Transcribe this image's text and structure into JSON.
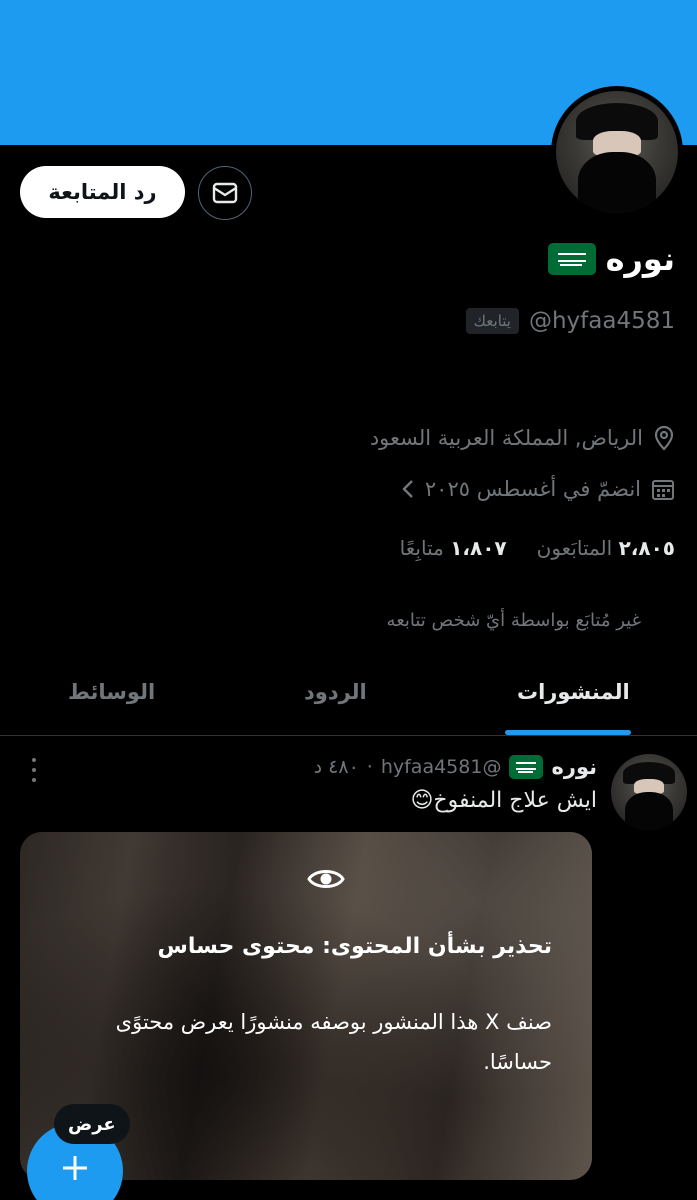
{
  "profile": {
    "name": "نوره",
    "flag_icon": "saudi-flag-icon",
    "handle": "@hyfaa4581",
    "follows_you": "يتابعك",
    "location": "الرياض, المملكة العربية السعود",
    "joined": "انضمّ في أغسطس ٢٠٢٥",
    "followers_count": "٢،٨٠٥",
    "followers_label": "المتابَعون",
    "following_count": "١،٨٠٧",
    "following_label": "متابِعًا",
    "not_followed_text": "غير مُتابَع بواسطة أيّ شخص تتابعه"
  },
  "actions": {
    "follow_back": "رد المتابعة",
    "message_icon": "envelope-icon"
  },
  "tabs": [
    {
      "label": "المنشورات",
      "active": true
    },
    {
      "label": "الردود",
      "active": false
    },
    {
      "label": "الوسائط",
      "active": false
    }
  ],
  "post": {
    "name": "نوره",
    "handle": "@hyfaa4581",
    "time": "٤٨٠ د",
    "separator": "·",
    "text": "ايش علاج المنفوخ😊",
    "warning_title": "تحذير بشأن المحتوى: محتوى حساس",
    "warning_body": "صنف X هذا المنشور بوصفه منشورًا يعرض محتوًى حساسًا.",
    "show_label": "عرض"
  },
  "colors": {
    "accent": "#1d9bf0",
    "background": "#000000",
    "secondary_text": "#71767b"
  }
}
